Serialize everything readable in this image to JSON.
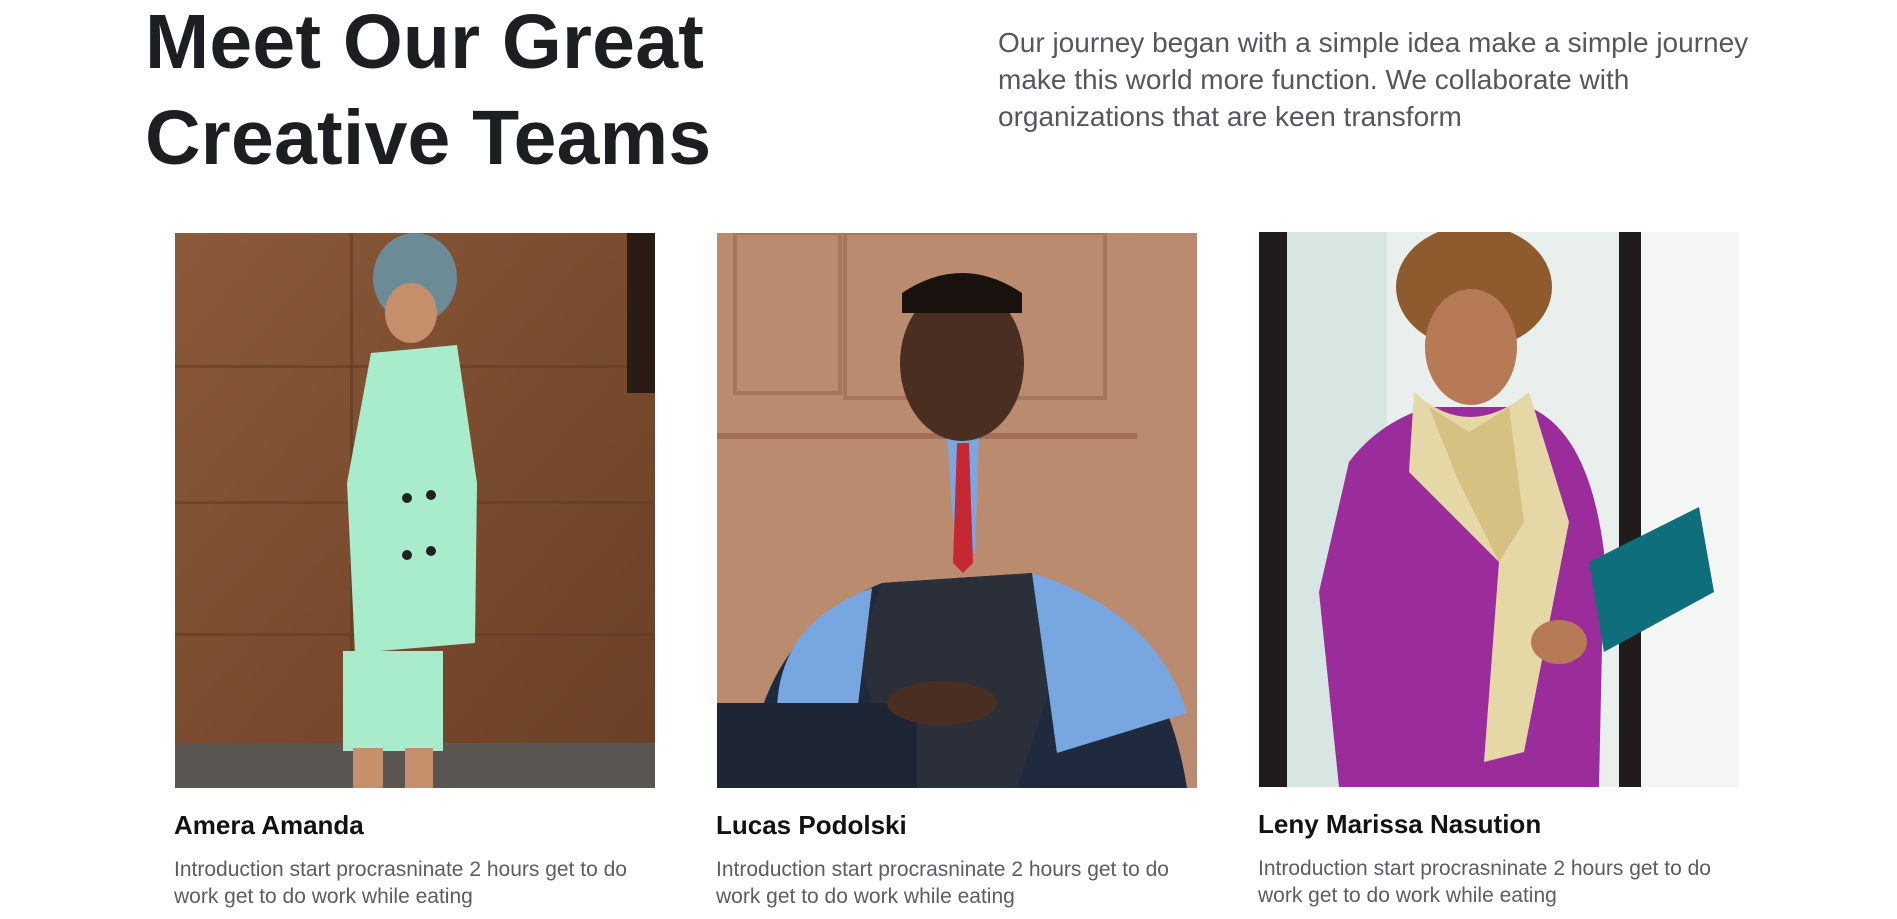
{
  "header": {
    "title_line1": "Meet Our Great",
    "title_line2": "Creative Teams",
    "intro": "Our journey began with a simple idea make a simple journey make this world more function. We collaborate with organizations that are keen transform"
  },
  "team": [
    {
      "name": "Amera Amanda",
      "bio": "Introduction start procrasninate 2 hours get to do work get to do work while eating"
    },
    {
      "name": "Lucas Podolski",
      "bio": "Introduction start procrasninate 2 hours get to do work get to do work while eating"
    },
    {
      "name": "Leny Marissa Nasution",
      "bio": "Introduction start procrasninate 2 hours get to do work get to do work while eating"
    }
  ],
  "colors": {
    "heading": "#1d1e22",
    "body_text": "#55575d",
    "background": "#ffffff"
  }
}
